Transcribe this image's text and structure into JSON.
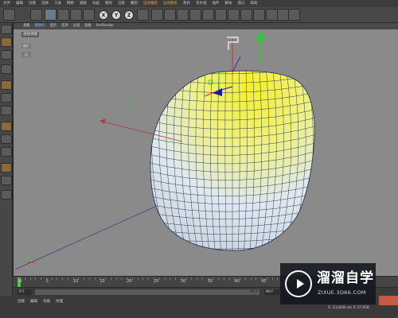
{
  "menu": {
    "items": [
      "文件",
      "编辑",
      "创建",
      "选择",
      "工具",
      "网格",
      "捕捉",
      "动画",
      "模拟",
      "渲染",
      "雕刻",
      "运动跟踪",
      "运动图形",
      "角色",
      "流水线",
      "插件",
      "脚本",
      "窗口",
      "帮助"
    ],
    "highlighted": [
      "运动跟踪",
      "运动图形"
    ]
  },
  "toolbar": {
    "buttons": [
      "undo-icon",
      "live-select-icon",
      "move-icon",
      "scale-icon",
      "rotate-icon",
      "recent-icon",
      "x-axis-button",
      "y-axis-button",
      "z-axis-button",
      "world-coordinates-icon",
      "render-view-icon",
      "render-picture-viewer-icon",
      "render-settings-icon",
      "cube-icon",
      "pen-icon",
      "subdivision-icon",
      "array-icon",
      "nurbs-icon",
      "deformer-icon",
      "floor-icon",
      "camera-icon",
      "light-icon"
    ],
    "axis_labels": [
      "X",
      "Y",
      "Z"
    ]
  },
  "viewport": {
    "menu": [
      "查看",
      "摄像机",
      "显示",
      "选项",
      "过滤",
      "面板",
      "ProRender"
    ],
    "active_menu": "摄像机",
    "title": "透视视图",
    "side_labels": [
      "图片",
      "层"
    ]
  },
  "timeline": {
    "ticks": [
      "0",
      "5",
      "10",
      "15",
      "20",
      "25",
      "30",
      "35",
      "40",
      "45",
      "50",
      "55"
    ],
    "current_frame": 0
  },
  "range": {
    "start": "0 F",
    "end_inner": "90 F",
    "end": "90 F"
  },
  "bottom": {
    "tabs": [
      "创建",
      "编辑",
      "功能",
      "纹理"
    ],
    "coords": "X  -13.828 cm   X  37.656"
  },
  "watermark": {
    "title": "溜溜自学",
    "url": "ZIXUE.3D66.COM"
  },
  "colors": {
    "viewport_bg": "#8a8a8a",
    "mesh_fill_top": "#f5f02a",
    "mesh_fill_bottom": "#dfe8f0",
    "mesh_wire": "#1c2a4a",
    "axis_x": "#c83232",
    "axis_y": "#32c83a",
    "axis_z": "#3232c8",
    "timeline_cursor": "#4ec43e"
  }
}
